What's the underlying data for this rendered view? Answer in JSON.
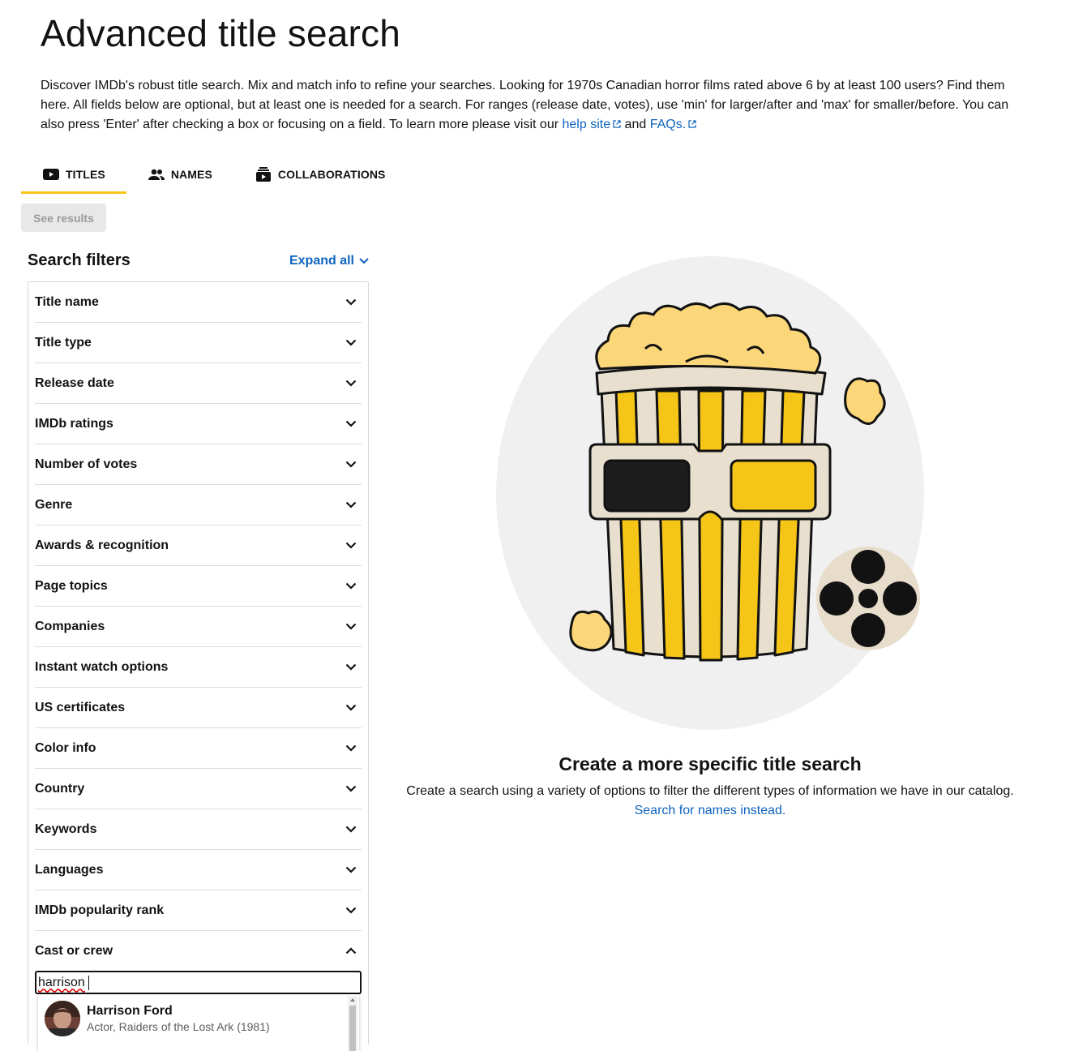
{
  "page": {
    "title": "Advanced title search",
    "intro": "Discover IMDb's robust title search. Mix and match info to refine your searches. Looking for 1970s Canadian horror films rated above 6 by at least 100 users? Find them here. All fields below are optional, but at least one is needed for a search. For ranges (release date, votes), use 'min' for larger/after and 'max' for smaller/before. You can also press 'Enter' after checking a box or focusing on a field. To learn more please visit our",
    "help_link": "help site",
    "and_text": "and",
    "faq_link": "FAQs."
  },
  "tabs": [
    {
      "label": "TITLES",
      "icon": "video-icon",
      "active": true
    },
    {
      "label": "NAMES",
      "icon": "people-icon",
      "active": false
    },
    {
      "label": "COLLABORATIONS",
      "icon": "collection-icon",
      "active": false
    }
  ],
  "see_results": "See results",
  "filters": {
    "title": "Search filters",
    "expand_all": "Expand all",
    "items": [
      "Title name",
      "Title type",
      "Release date",
      "IMDb ratings",
      "Number of votes",
      "Genre",
      "Awards & recognition",
      "Page topics",
      "Companies",
      "Instant watch options",
      "US certificates",
      "Color info",
      "Country",
      "Keywords",
      "Languages",
      "IMDb popularity rank",
      "Cast or crew"
    ],
    "expanded": "Cast or crew",
    "cast_input_value": "harrison",
    "suggestion": {
      "name": "Harrison Ford",
      "subtitle": "Actor, Raiders of the Lost Ark (1981)"
    }
  },
  "empty_state": {
    "title": "Create a more specific title search",
    "description": "Create a search using a variety of options to filter the different types of information we have in our catalog.",
    "link": "Search for names instead."
  },
  "colors": {
    "accent": "#f5c518",
    "link": "#0e63be"
  }
}
